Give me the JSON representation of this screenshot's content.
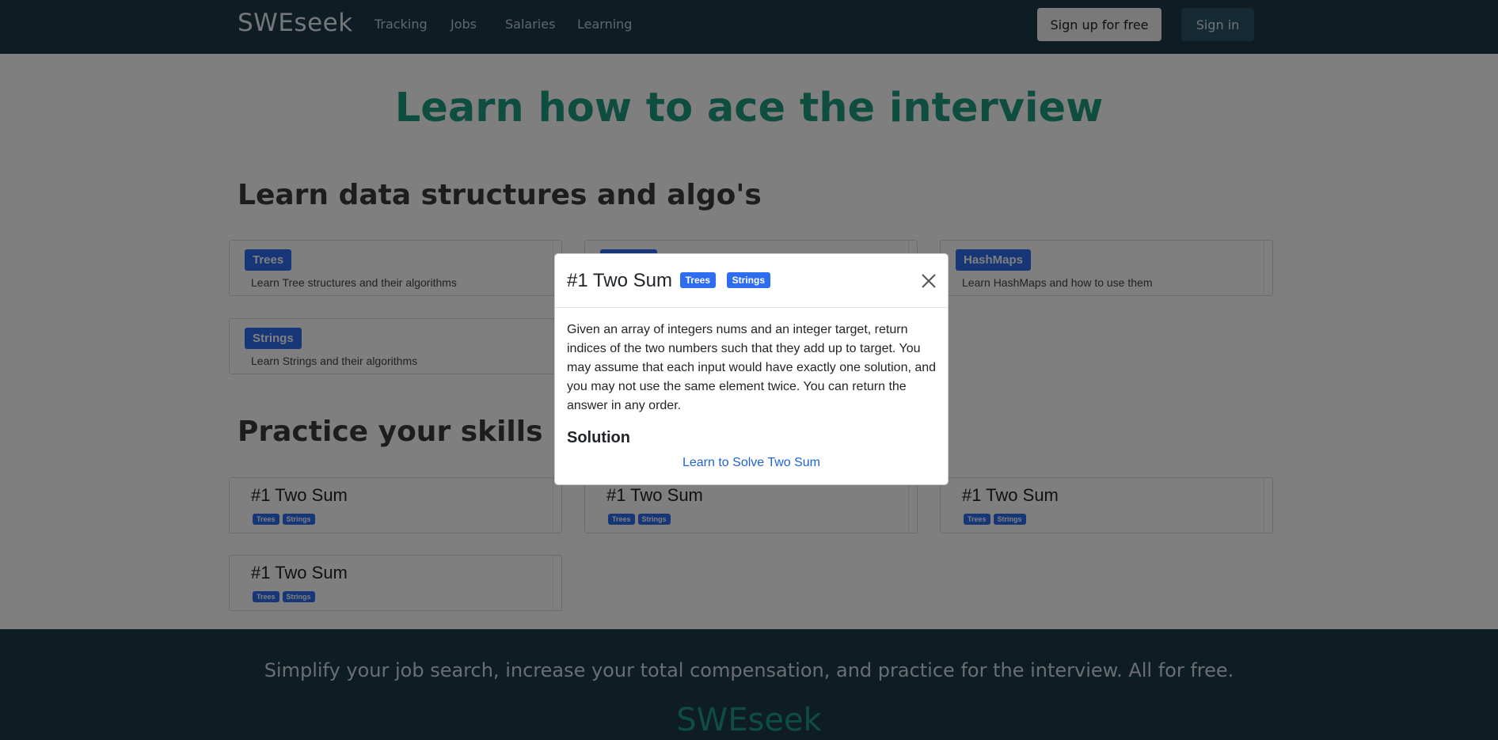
{
  "navbar": {
    "brand": "SWEseek",
    "links": [
      "Tracking",
      "Jobs",
      "Salaries",
      "Learning"
    ],
    "signup_label": "Sign up for free",
    "signin_label": "Sign in"
  },
  "hero": {
    "title": "Learn how to ace the interview"
  },
  "learn": {
    "title": "Learn data structures and algo's",
    "topics": [
      {
        "badge": "Trees",
        "description": "Learn Tree structures and their algorithms"
      },
      {
        "badge": "",
        "description": ""
      },
      {
        "badge": "HashMaps",
        "description": "Learn HashMaps and how to use them"
      },
      {
        "badge": "Strings",
        "description": "Learn Strings and their algorithms"
      }
    ]
  },
  "practice": {
    "title": "Practice your skills",
    "problems": [
      {
        "title": "#1 Two Sum",
        "tags": [
          "Trees",
          "Strings"
        ]
      },
      {
        "title": "#1 Two Sum",
        "tags": [
          "Trees",
          "Strings"
        ]
      },
      {
        "title": "#1 Two Sum",
        "tags": [
          "Trees",
          "Strings"
        ]
      },
      {
        "title": "#1 Two Sum",
        "tags": [
          "Trees",
          "Strings"
        ]
      }
    ]
  },
  "footer": {
    "tagline": "Simplify your job search, increase your total compensation, and practice for the interview. All for free.",
    "brand": "SWEseek"
  },
  "modal": {
    "title": "#1 Two Sum",
    "tags": [
      "Trees",
      "Strings"
    ],
    "body": "Given an array of integers nums and an integer target, return indices of the two numbers such that they add up to target. You may assume that each input would have exactly one solution, and you may not use the same element twice. You can return the answer in any order.",
    "solution_heading": "Solution",
    "solution_link": "Learn to Solve Two Sum"
  },
  "colors": {
    "navbar_bg": "#1d3948",
    "accent_teal": "#1f9a82",
    "badge_blue": "#2f6df0",
    "link_blue": "#1f63d8"
  }
}
